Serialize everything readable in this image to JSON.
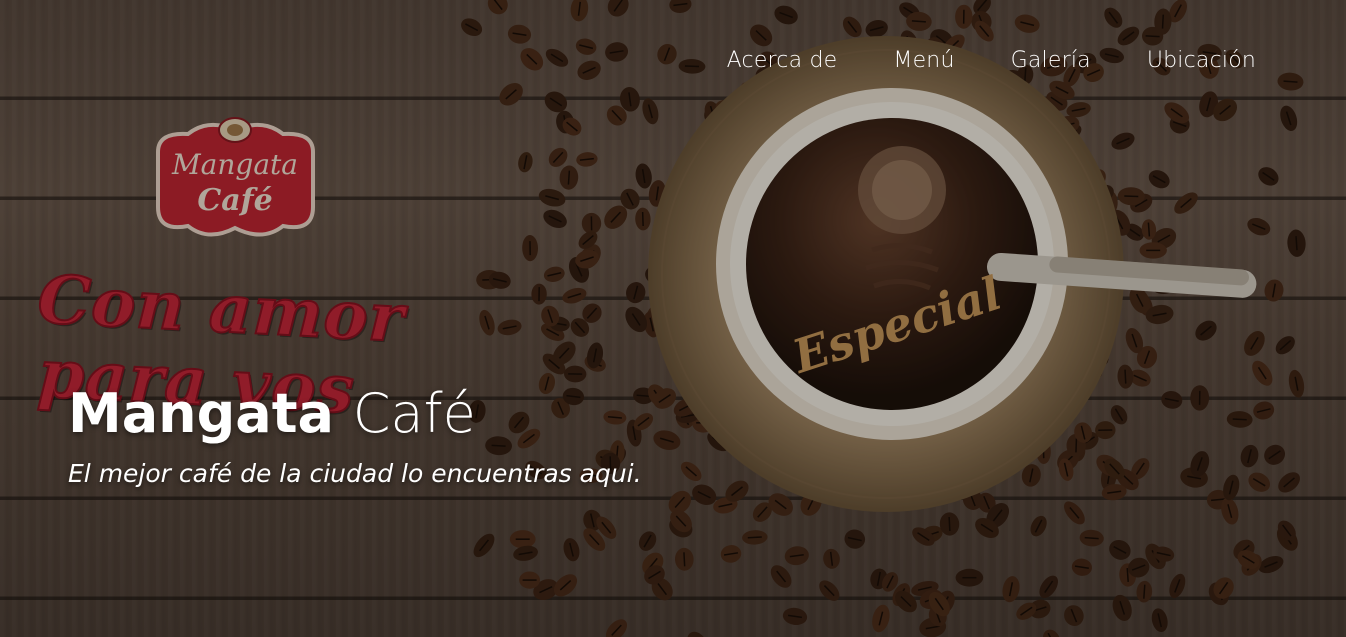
{
  "nav": {
    "items": [
      {
        "label": "Acerca de"
      },
      {
        "label": "Menú"
      },
      {
        "label": "Galería"
      },
      {
        "label": "Ubicación"
      }
    ]
  },
  "background": {
    "logo_text_1": "Mangata",
    "logo_text_2": "Café",
    "slogan_line_1": "Con amor",
    "slogan_line_2": "para vos",
    "cup_text": "Especial"
  },
  "hero": {
    "title_bold": "Mangata",
    "title_light": "Café",
    "subtitle": "El mejor café de la ciudad lo encuentras aqui."
  },
  "colors": {
    "wood": "#5b4b40",
    "logo_red": "#c8283a",
    "text": "#ffffff",
    "cup_print": "#c9995a"
  }
}
